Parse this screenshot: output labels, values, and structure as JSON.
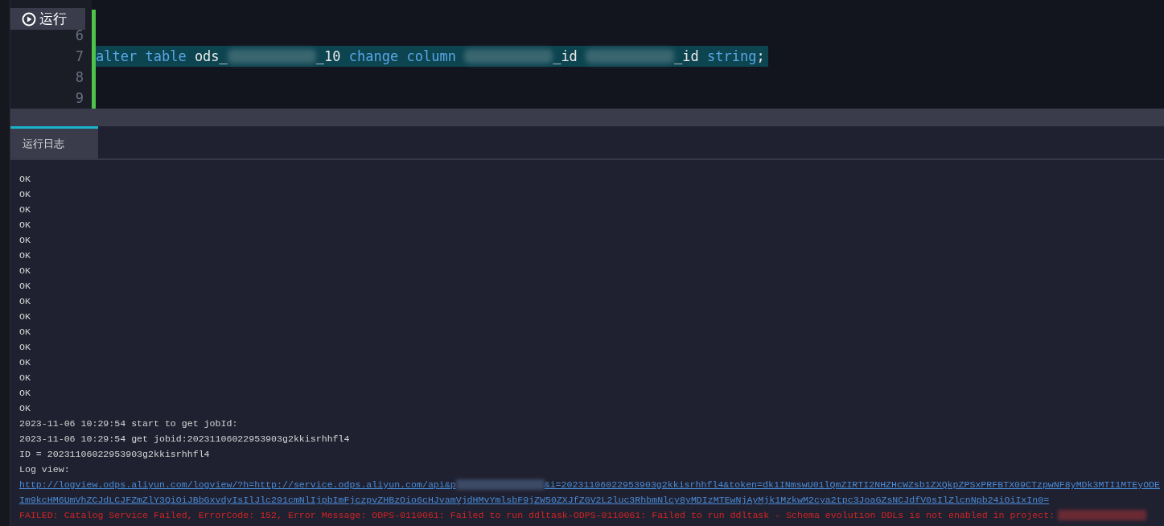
{
  "editor": {
    "run_button": {
      "label": "运行"
    },
    "lines": [
      {
        "number": "6"
      },
      {
        "number": "7",
        "tokens": [
          {
            "kind": "keyword",
            "text": "alter"
          },
          {
            "kind": "keyword",
            "text": "table"
          },
          {
            "kind": "plain",
            "text": "ods_"
          },
          {
            "kind": "redacted",
            "joined": true
          },
          {
            "kind": "plain",
            "text": "_10",
            "joined": true
          },
          {
            "kind": "keyword",
            "text": "change"
          },
          {
            "kind": "keyword",
            "text": "column"
          },
          {
            "kind": "redacted"
          },
          {
            "kind": "plain",
            "text": "_id",
            "joined": true
          },
          {
            "kind": "redacted"
          },
          {
            "kind": "plain",
            "text": "_id",
            "joined": true
          },
          {
            "kind": "keyword",
            "text": "string"
          },
          {
            "kind": "plain",
            "text": ";",
            "joined": true
          }
        ]
      },
      {
        "number": "8"
      },
      {
        "number": "9"
      }
    ]
  },
  "log_panel": {
    "tabs": [
      {
        "label": "运行日志",
        "selected": true
      }
    ],
    "lines": [
      {
        "kind": "plain",
        "text": "OK"
      },
      {
        "kind": "plain",
        "text": "OK"
      },
      {
        "kind": "plain",
        "text": "OK"
      },
      {
        "kind": "plain",
        "text": "OK"
      },
      {
        "kind": "plain",
        "text": "OK"
      },
      {
        "kind": "plain",
        "text": "OK"
      },
      {
        "kind": "plain",
        "text": "OK"
      },
      {
        "kind": "plain",
        "text": "OK"
      },
      {
        "kind": "plain",
        "text": "OK"
      },
      {
        "kind": "plain",
        "text": "OK"
      },
      {
        "kind": "plain",
        "text": "OK"
      },
      {
        "kind": "plain",
        "text": "OK"
      },
      {
        "kind": "plain",
        "text": "OK"
      },
      {
        "kind": "plain",
        "text": "OK"
      },
      {
        "kind": "plain",
        "text": "OK"
      },
      {
        "kind": "plain",
        "text": "OK"
      },
      {
        "kind": "plain",
        "text": "2023-11-06 10:29:54 start to get jobId:"
      },
      {
        "kind": "plain",
        "text": "2023-11-06 10:29:54 get jobid:20231106022953903g2kkisrhhfl4"
      },
      {
        "kind": "plain",
        "text": "ID = 20231106022953903g2kkisrhhfl4"
      },
      {
        "kind": "plain",
        "text": "Log view:"
      },
      {
        "kind": "link",
        "text": "http://logview.odps.aliyun.com/logview/?h=http://service.odps.aliyun.com/api&p",
        "text_after": "&i=20231106022953903g2kkisrhhfl4&token=dk1INmswU01lQmZIRTI2NHZHcWZsb1ZXQkpZPSxPRFBTX09CTzpwNF8yMDk3MTI1MTEyODE"
      },
      {
        "kind": "link",
        "text": "Im9kcHM6UmVhZCJdLCJFZmZlY3QiOiJBbGxvdyIsIlJlc291cmNlIjpbImFjczpvZHBzOio6cHJvamVjdHMvYmlsbF9jZW50ZXJfZGV2L2luc3RhbmNlcy8yMDIzMTEwNjAyMjk1MzkwM2cya2tpc3JoaGZsNCJdfV0sIlZlcnNpb24iOiIxIn0="
      },
      {
        "kind": "error",
        "text": "FAILED: Catalog Service Failed, ErrorCode: 152, Error Message: ODPS-0110061: Failed to run ddltask-ODPS-0110061: Failed to run ddltask - Schema evolution DDLs is not enabled in project:",
        "redacted_after": true
      }
    ]
  }
}
